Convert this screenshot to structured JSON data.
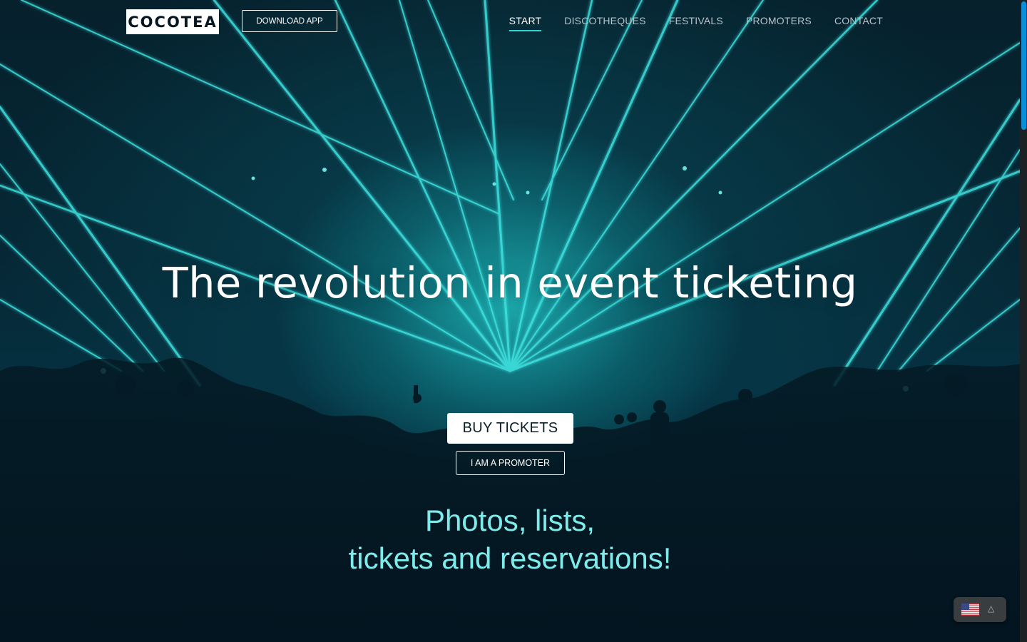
{
  "header": {
    "logo_text": "COCOTEA",
    "download_label": "DOWNLOAD APP",
    "nav": [
      {
        "label": "START",
        "active": true
      },
      {
        "label": "DISCOTHEQUES",
        "active": false
      },
      {
        "label": "FESTIVALS",
        "active": false
      },
      {
        "label": "PROMOTERS",
        "active": false
      },
      {
        "label": "CONTACT",
        "active": false
      }
    ]
  },
  "hero": {
    "headline": "The revolution in event ticketing",
    "buy_label": "BUY TICKETS",
    "promoter_label": "I AM A PROMOTER",
    "tagline_line1": "Photos, lists,",
    "tagline_line2": "tickets and reservations!"
  },
  "language": {
    "flag_icon": "us-flag-icon",
    "toggle_icon": "chevron-up-icon"
  },
  "colors": {
    "accent": "#35d4d4",
    "tagline": "#7fecec",
    "background": "#041a24",
    "scroll_thumb": "#0a8fd8"
  }
}
